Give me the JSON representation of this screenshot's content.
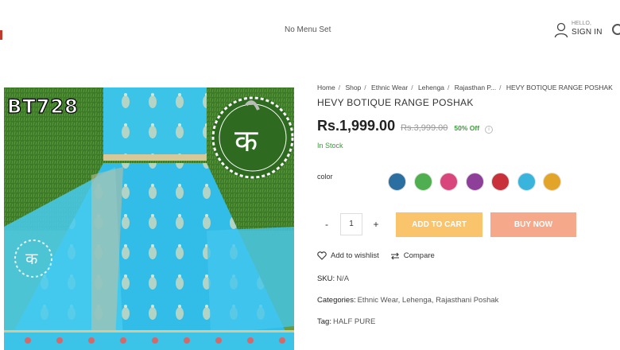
{
  "header": {
    "menu_text": "No Menu Set",
    "account": {
      "greeting": "HELLO,",
      "signin": "SIGN IN"
    }
  },
  "product_image": {
    "code": "BT728",
    "logo_glyph": "क"
  },
  "breadcrumb": [
    "Home",
    "Shop",
    "Ethnic Wear",
    "Lehenga",
    "Rajasthan P...",
    "HEVY BOTIQUE RANGE POSHAK"
  ],
  "product": {
    "title": "HEVY BOTIQUE RANGE POSHAK",
    "price": "Rs.1,999.00",
    "old_price": "Rs.3,999.00",
    "discount": "50% Off",
    "stock": "In Stock",
    "color_label": "color",
    "swatches": [
      "#2a6fa0",
      "#4fae4f",
      "#d8467b",
      "#8e3f9a",
      "#c8303a",
      "#39b4dc",
      "#e2a52a"
    ],
    "quantity": "1",
    "qty_minus": "-",
    "qty_plus": "+",
    "add_to_cart": "ADD TO CART",
    "buy_now": "BUY NOW",
    "wishlist": "Add to wishlist",
    "compare": "Compare",
    "sku_label": "SKU:",
    "sku_value": "N/A",
    "categories_label": "Categories:",
    "categories_value": "Ethnic Wear, Lehenga, Rajasthani Poshak",
    "tag_label": "Tag:",
    "tag_value": "HALF PURE"
  },
  "colors": {
    "accent_yellow": "#f9c46b",
    "accent_orange": "#f6a98a",
    "stock_green": "#3a9b3a"
  }
}
